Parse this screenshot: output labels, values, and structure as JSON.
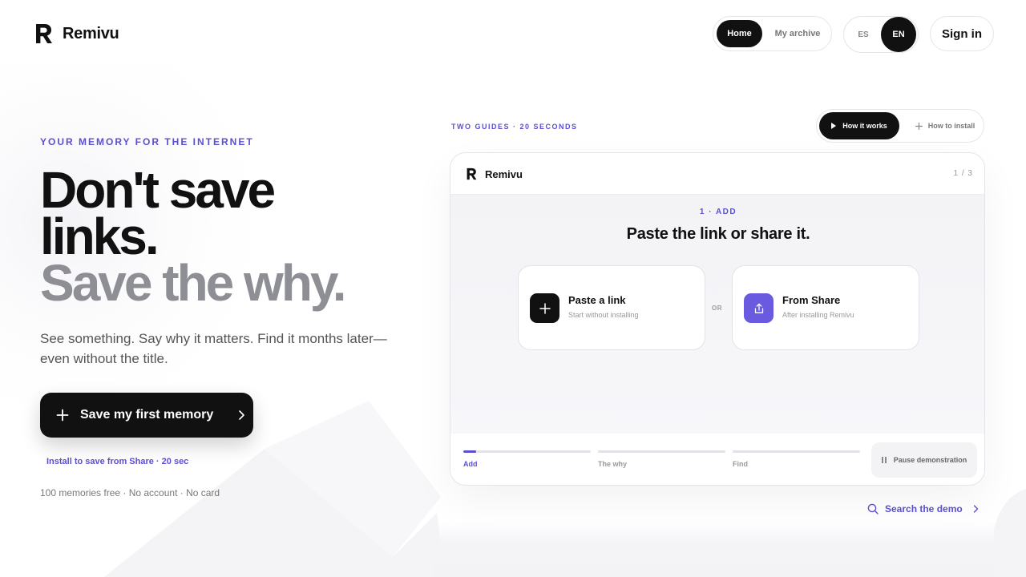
{
  "header": {
    "brand": "Remivu",
    "nav": {
      "home": "Home",
      "archive": "My archive"
    },
    "lang": {
      "es": "ES",
      "en": "EN"
    },
    "signin": "Sign in"
  },
  "hero": {
    "eyebrow": "YOUR MEMORY FOR THE INTERNET",
    "headline_line1": "Don't save",
    "headline_line2": "links.",
    "headline_line3": "Save the why.",
    "subtext": "See something. Say why it matters. Find it months later—even without the title.",
    "cta": "Save my first memory",
    "install_link": "Install to save from Share · 20 sec",
    "free_note": "100 memories free · No account · No card"
  },
  "demo": {
    "guides_label": "TWO GUIDES · 20 SECONDS",
    "switch": {
      "how": "How it works",
      "install": "How to install"
    },
    "brand": "Remivu",
    "page": "1 / 3",
    "step_label": "1 · ADD",
    "step_title": "Paste the link or share it.",
    "options": {
      "paste": {
        "title": "Paste a link",
        "sub": "Start without installing"
      },
      "share": {
        "title": "From Share",
        "sub": "After installing Remivu"
      }
    },
    "or": "OR",
    "progress": [
      {
        "label": "Add",
        "fill": 0.1,
        "active": true
      },
      {
        "label": "The why",
        "fill": 0,
        "active": false
      },
      {
        "label": "Find",
        "fill": 0,
        "active": false
      }
    ],
    "pause": "Pause demonstration",
    "search": "Search the demo"
  },
  "colors": {
    "accent": "#5b4fd1",
    "dark": "#111111",
    "share_icon_bg": "#6a5ae0",
    "headline_gray": "#8e8e95"
  },
  "icons": {
    "logo": "remivu-r-logo",
    "cta_plus": "plus-icon",
    "cta_chevron": "chevron-right-icon",
    "paste": "plus-icon",
    "share": "share-upload-icon",
    "play": "play-icon",
    "pause": "pause-icon",
    "search": "search-icon"
  }
}
